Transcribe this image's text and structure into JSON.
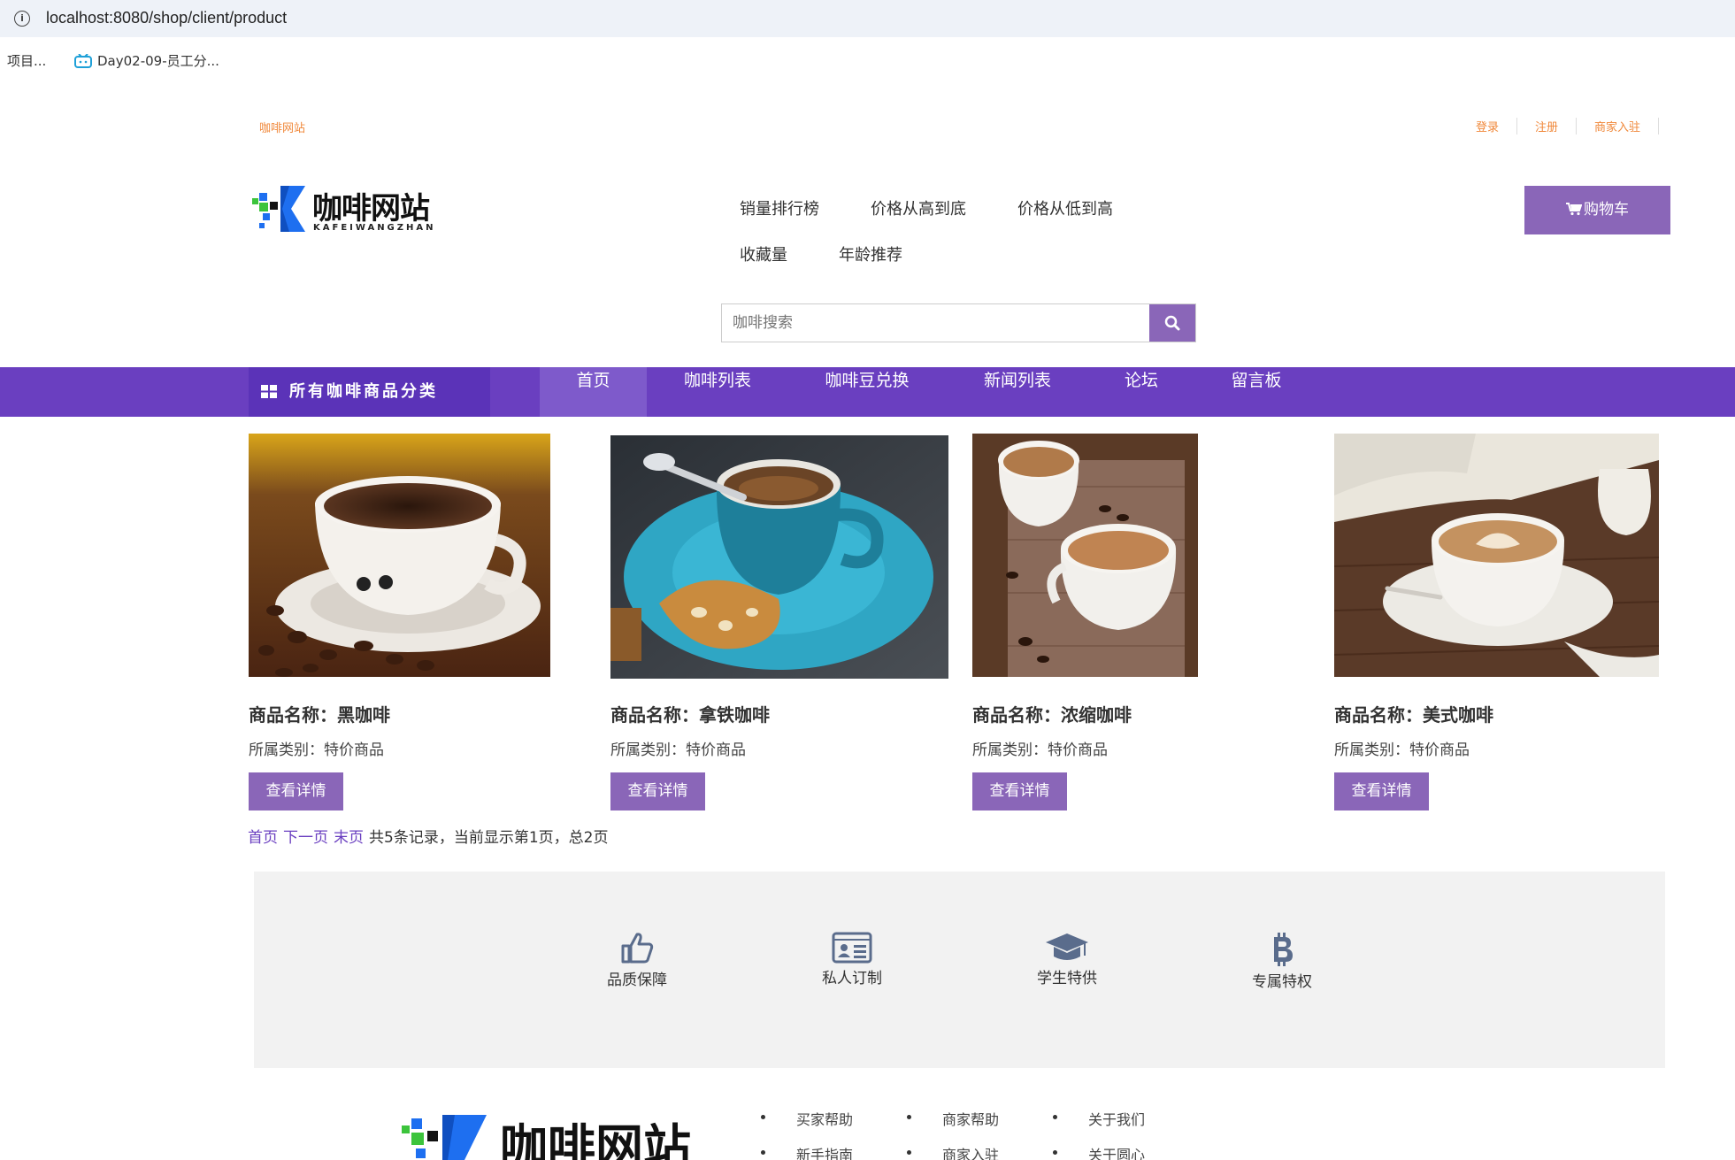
{
  "browser": {
    "url": "localhost:8080/shop/client/product",
    "bookmarks": [
      "项目...",
      "Day02-09-员工分..."
    ]
  },
  "header": {
    "site_small": "咖啡网站",
    "top_links": [
      "登录",
      "注册",
      "商家入驻"
    ],
    "logo_text": "咖啡网站",
    "logo_sub": "KAFEIWANGZHAN",
    "sort_links": [
      "销量排行榜",
      "价格从高到底",
      "价格从低到高",
      "收藏量",
      "年龄推荐"
    ],
    "cart_label": "购物车",
    "search_placeholder": "咖啡搜索"
  },
  "navbar": {
    "category_label": "所有咖啡商品分类",
    "items": [
      "首页",
      "咖啡列表",
      "咖啡豆兑换",
      "新闻列表",
      "论坛",
      "留言板"
    ],
    "active": "首页"
  },
  "products": [
    {
      "name": "商品名称：黑咖啡",
      "category": "所属类别：特价商品",
      "button": "查看详情"
    },
    {
      "name": "商品名称：拿铁咖啡",
      "category": "所属类别：特价商品",
      "button": "查看详情"
    },
    {
      "name": "商品名称：浓缩咖啡",
      "category": "所属类别：特价商品",
      "button": "查看详情"
    },
    {
      "name": "商品名称：美式咖啡",
      "category": "所属类别：特价商品",
      "button": "查看详情"
    }
  ],
  "pager": {
    "first": "首页",
    "next": "下一页",
    "last": "末页",
    "summary": "共5条记录，当前显示第1页，总2页"
  },
  "features": [
    {
      "label": "品质保障",
      "icon": "thumbs-up-icon"
    },
    {
      "label": "私人订制",
      "icon": "id-card-icon"
    },
    {
      "label": "学生特供",
      "icon": "graduation-cap-icon"
    },
    {
      "label": "专属特权",
      "icon": "bitcoin-icon"
    }
  ],
  "footer": {
    "logo_text": "咖啡网站",
    "links": [
      [
        "买家帮助",
        "新手指南"
      ],
      [
        "商家帮助",
        "商家入驻"
      ],
      [
        "关于我们",
        "关于圆心"
      ]
    ]
  },
  "colors": {
    "accent": "#8a66b8",
    "navbar": "#6a3fc0",
    "orange_links": "#f0883a"
  }
}
